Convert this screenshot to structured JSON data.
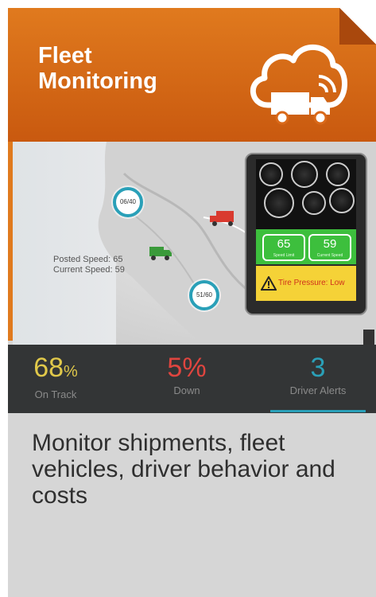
{
  "header": {
    "title_line1": "Fleet",
    "title_line2": "Monitoring",
    "icon": "cloud-truck-icon",
    "color": "#d9691a"
  },
  "map": {
    "posted_speed": "Posted Speed: 65",
    "current_speed": "Current Speed: 59",
    "pin1_label": "06/40",
    "pin2_label": "51/60"
  },
  "dashboard": {
    "speed_value": "65",
    "speed_label": "Speed Limit",
    "current_value": "59",
    "current_label": "Current Speed",
    "alert_text": "Tire Pressure: Low"
  },
  "stats": [
    {
      "value": "68",
      "unit": "%",
      "label": "On Track",
      "color": "#e0c84a"
    },
    {
      "value": "5%",
      "label": "Down",
      "color": "#e0453f"
    },
    {
      "value": "3",
      "label": "Driver Alerts",
      "color": "#2aa0b8"
    }
  ],
  "description": "Monitor shipments, fleet vehicles, driver behavior and costs"
}
